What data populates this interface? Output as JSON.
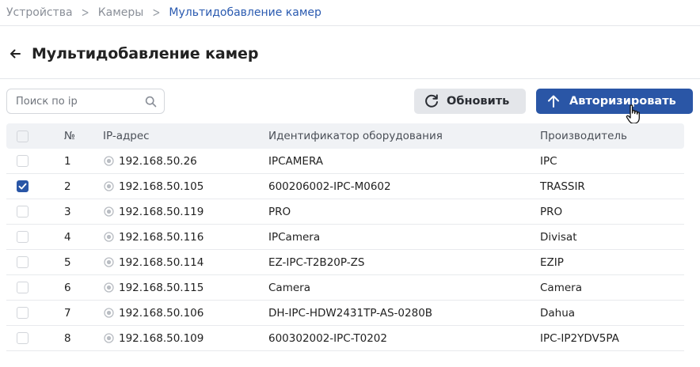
{
  "breadcrumb": {
    "items": [
      "Устройства",
      "Камеры",
      "Мультидобавление камер"
    ]
  },
  "page": {
    "title": "Мультидобавление камер"
  },
  "search": {
    "placeholder": "Поиск по ip",
    "value": ""
  },
  "toolbar": {
    "refresh_label": "Обновить",
    "authorize_label": "Авторизировать"
  },
  "colors": {
    "accent": "#2a56a6",
    "breadcrumb_current": "#2a5ab0",
    "header_bg": "#f0f2f5"
  },
  "table": {
    "columns": [
      "№",
      "IP-адрес",
      "Идентификатор оборудования",
      "Производитель"
    ],
    "rows": [
      {
        "num": "1",
        "ip": "192.168.50.26",
        "id": "IPCAMERA",
        "manufacturer": "IPC",
        "checked": false
      },
      {
        "num": "2",
        "ip": "192.168.50.105",
        "id": "600206002-IPC-M0602",
        "manufacturer": "TRASSIR",
        "checked": true
      },
      {
        "num": "3",
        "ip": "192.168.50.119",
        "id": "PRO",
        "manufacturer": "PRO",
        "checked": false
      },
      {
        "num": "4",
        "ip": "192.168.50.116",
        "id": "IPCamera",
        "manufacturer": "Divisat",
        "checked": false
      },
      {
        "num": "5",
        "ip": "192.168.50.114",
        "id": "EZ-IPC-T2B20P-ZS",
        "manufacturer": "EZIP",
        "checked": false
      },
      {
        "num": "6",
        "ip": "192.168.50.115",
        "id": "Camera",
        "manufacturer": "Camera",
        "checked": false
      },
      {
        "num": "7",
        "ip": "192.168.50.106",
        "id": "DH-IPC-HDW2431TP-AS-0280B",
        "manufacturer": "Dahua",
        "checked": false
      },
      {
        "num": "8",
        "ip": "192.168.50.109",
        "id": "600302002-IPC-T0202",
        "manufacturer": "IPC-IP2YDV5PA",
        "checked": false
      }
    ]
  }
}
